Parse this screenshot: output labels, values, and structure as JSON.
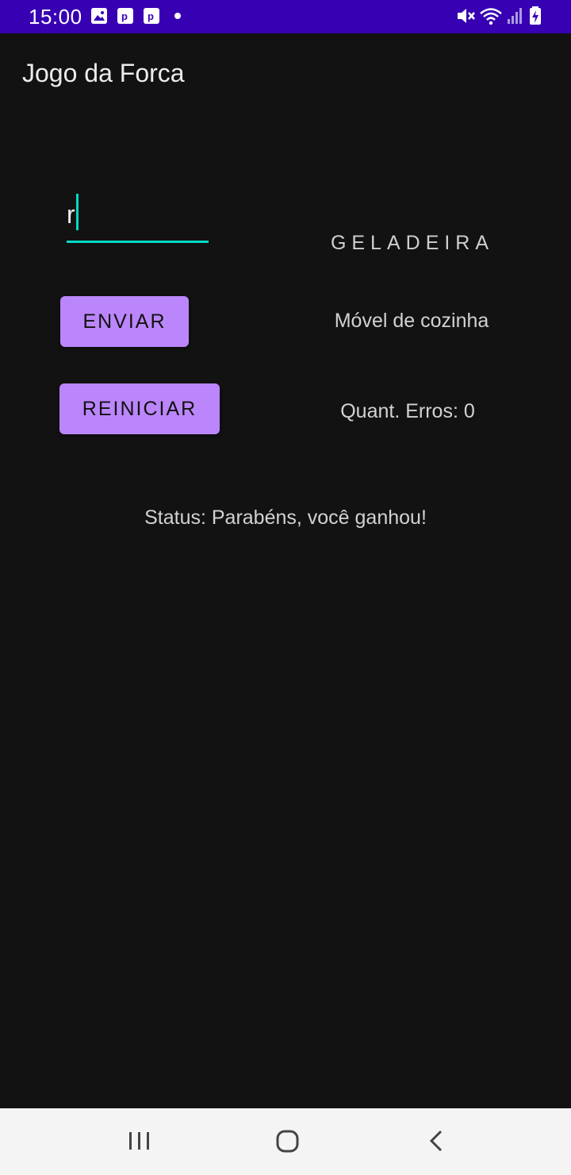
{
  "status_bar": {
    "time": "15:00",
    "background": "#3700b3",
    "left_icons": [
      "image-notification-icon",
      "parking-app-icon",
      "parking-app-icon",
      "dot-icon"
    ],
    "right_icons": [
      "mute-icon",
      "wifi-icon",
      "signal-icon",
      "battery-charging-icon"
    ]
  },
  "app_bar": {
    "title": "Jogo da Forca"
  },
  "game": {
    "letter_input_value": "r",
    "word": "GELADEIRA",
    "send_label": "ENVIAR",
    "hint": "Móvel de cozinha",
    "restart_label": "REINICIAR",
    "errors_text": "Quant. Erros: 0",
    "status_text": "Status: Parabéns, você ganhou!"
  },
  "colors": {
    "background": "#121212",
    "button": "#bb86fc",
    "accent": "#03dac5"
  },
  "nav_bar": {
    "buttons": [
      "recent-apps-icon",
      "home-icon",
      "back-icon"
    ]
  }
}
